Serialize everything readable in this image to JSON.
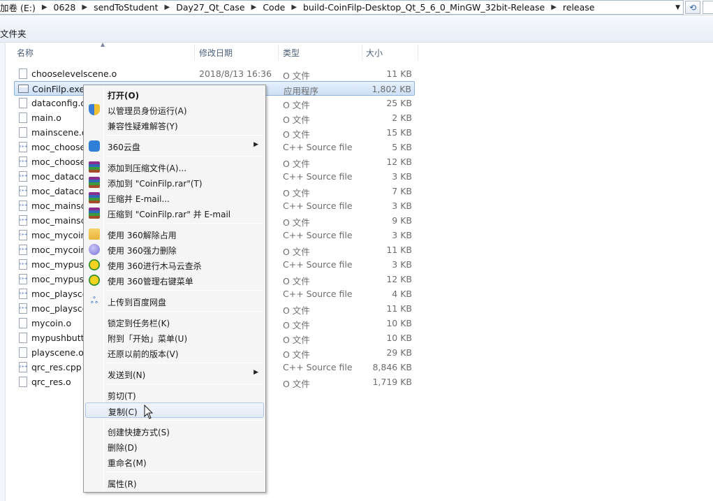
{
  "address_bar": {
    "crumbs": [
      "加卷 (E:)",
      "0628",
      "sendToStudent",
      "Day27_Qt_Case",
      "Code",
      "build-CoinFilp-Desktop_Qt_5_6_0_MinGW_32bit-Release",
      "release"
    ]
  },
  "toolbar": {
    "label": "文件夹"
  },
  "columns": {
    "name": "名称",
    "date": "修改日期",
    "type": "类型",
    "size": "大小"
  },
  "files": [
    {
      "name": "chooselevelscene.o",
      "date": "2018/8/13 16:36",
      "type": "O 文件",
      "size": "11 KB",
      "icon": "file-icon"
    },
    {
      "name": "CoinFilp.exe",
      "date": "",
      "type": "应用程序",
      "size": "1,802 KB",
      "icon": "exe-icon"
    },
    {
      "name": "dataconfig.o",
      "date": "",
      "type": "O 文件",
      "size": "25 KB",
      "icon": "file-icon"
    },
    {
      "name": "main.o",
      "date": "",
      "type": "O 文件",
      "size": "2 KB",
      "icon": "file-icon"
    },
    {
      "name": "mainscene.o",
      "date": "",
      "type": "O 文件",
      "size": "15 KB",
      "icon": "file-icon"
    },
    {
      "name": "moc_choosel",
      "date": "",
      "type": "C++ Source file",
      "size": "5 KB",
      "icon": "cpp-file-icon"
    },
    {
      "name": "moc_choosel",
      "date": "",
      "type": "O 文件",
      "size": "12 KB",
      "icon": "file-icon"
    },
    {
      "name": "moc_dataco",
      "date": "",
      "type": "C++ Source file",
      "size": "3 KB",
      "icon": "cpp-file-icon"
    },
    {
      "name": "moc_dataco",
      "date": "",
      "type": "O 文件",
      "size": "7 KB",
      "icon": "file-icon"
    },
    {
      "name": "moc_mainsc",
      "date": "",
      "type": "C++ Source file",
      "size": "3 KB",
      "icon": "cpp-file-icon"
    },
    {
      "name": "moc_mainsc",
      "date": "",
      "type": "O 文件",
      "size": "9 KB",
      "icon": "file-icon"
    },
    {
      "name": "moc_mycoin.",
      "date": "",
      "type": "C++ Source file",
      "size": "3 KB",
      "icon": "cpp-file-icon"
    },
    {
      "name": "moc_mycoin.",
      "date": "",
      "type": "O 文件",
      "size": "11 KB",
      "icon": "file-icon"
    },
    {
      "name": "moc_mypush",
      "date": "",
      "type": "C++ Source file",
      "size": "3 KB",
      "icon": "cpp-file-icon"
    },
    {
      "name": "moc_mypush",
      "date": "",
      "type": "O 文件",
      "size": "12 KB",
      "icon": "file-icon"
    },
    {
      "name": "moc_playsce",
      "date": "",
      "type": "C++ Source file",
      "size": "4 KB",
      "icon": "cpp-file-icon"
    },
    {
      "name": "moc_playsce",
      "date": "",
      "type": "O 文件",
      "size": "11 KB",
      "icon": "file-icon"
    },
    {
      "name": "mycoin.o",
      "date": "",
      "type": "O 文件",
      "size": "10 KB",
      "icon": "file-icon"
    },
    {
      "name": "mypushbutto",
      "date": "",
      "type": "O 文件",
      "size": "10 KB",
      "icon": "file-icon"
    },
    {
      "name": "playscene.o",
      "date": "",
      "type": "O 文件",
      "size": "29 KB",
      "icon": "file-icon"
    },
    {
      "name": "qrc_res.cpp",
      "date": "",
      "type": "C++ Source file",
      "size": "8,846 KB",
      "icon": "cpp-file-icon"
    },
    {
      "name": "qrc_res.o",
      "date": "",
      "type": "O 文件",
      "size": "1,719 KB",
      "icon": "file-icon"
    }
  ],
  "context_menu": {
    "open": "打开(O)",
    "run_as_admin": "以管理员身份运行(A)",
    "compat": "兼容性疑难解答(Y)",
    "cloud360": "360云盘",
    "add_archive": "添加到压缩文件(A)...",
    "add_rar": "添加到 \"CoinFilp.rar\"(T)",
    "compress_email": "压缩并 E-mail...",
    "compress_rar_email": "压缩到 \"CoinFilp.rar\" 并 E-mail",
    "unlock360": "使用 360解除占用",
    "delete360": "使用 360强力删除",
    "scan360": "使用 360进行木马云查杀",
    "menu360": "使用 360管理右键菜单",
    "baidu": "上传到百度网盘",
    "pin_taskbar": "锁定到任务栏(K)",
    "pin_start": "附到「开始」菜单(U)",
    "restore": "还原以前的版本(V)",
    "send_to": "发送到(N)",
    "cut": "剪切(T)",
    "copy": "复制(C)",
    "shortcut": "创建快捷方式(S)",
    "delete": "删除(D)",
    "rename": "重命名(M)",
    "properties": "属性(R)"
  },
  "colors": {
    "selection": "#cde0f6",
    "menu_bg": "#f5f5f5",
    "toolbar": "#e8eef7"
  }
}
